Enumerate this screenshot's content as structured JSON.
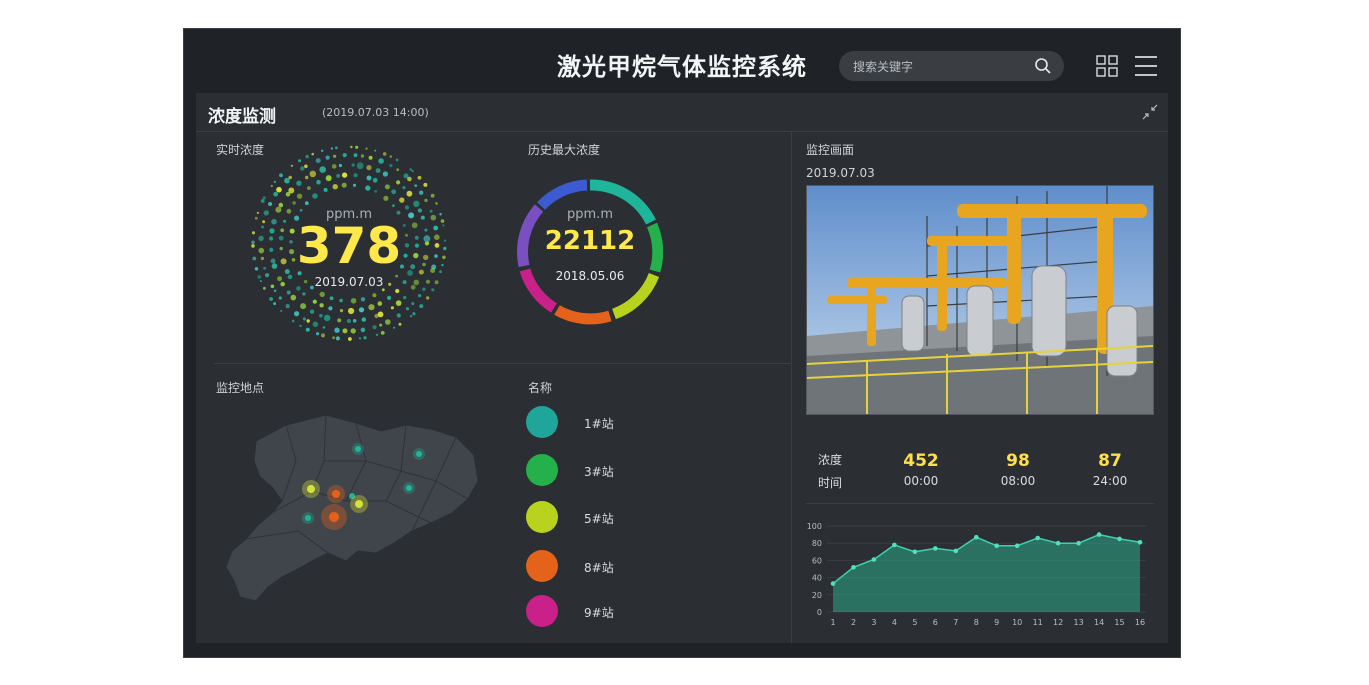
{
  "app": {
    "title": "激光甲烷气体监控系统"
  },
  "search": {
    "placeholder": "搜索关键字"
  },
  "panel": {
    "title": "浓度监测",
    "date": "(2019.07.03  14:00)"
  },
  "realtime": {
    "label": "实时浓度",
    "unit": "ppm.m",
    "value": "378",
    "date": "2019.07.03"
  },
  "history_max": {
    "label": "历史最大浓度",
    "unit": "ppm.m",
    "value": "22112",
    "date": "2018.05.06"
  },
  "map": {
    "label": "监控地点"
  },
  "stations": {
    "header": "名称",
    "items": [
      {
        "name": "1#站",
        "color": "#1fa59a"
      },
      {
        "name": "3#站",
        "color": "#24b04a"
      },
      {
        "name": "5#站",
        "color": "#b8d21e"
      },
      {
        "name": "8#站",
        "color": "#e5621b"
      },
      {
        "name": "9#站",
        "color": "#c9208a"
      }
    ]
  },
  "monitor": {
    "label": "监控画面",
    "date": "2019.07.03"
  },
  "stats": {
    "conc_label": "浓度",
    "time_label": "时间",
    "values": [
      "452",
      "98",
      "87"
    ],
    "times": [
      "00:00",
      "08:00",
      "24:00"
    ]
  },
  "chart_data": {
    "type": "area",
    "x": [
      1,
      2,
      3,
      4,
      5,
      6,
      7,
      8,
      9,
      10,
      11,
      12,
      13,
      14,
      15,
      16
    ],
    "values": [
      33,
      52,
      61,
      78,
      70,
      74,
      71,
      87,
      77,
      77,
      86,
      80,
      80,
      90,
      85,
      81
    ],
    "ylim": [
      0,
      100
    ],
    "yticks": [
      0,
      20,
      40,
      60,
      80,
      100
    ],
    "grid": true,
    "color": "#2aa889"
  }
}
